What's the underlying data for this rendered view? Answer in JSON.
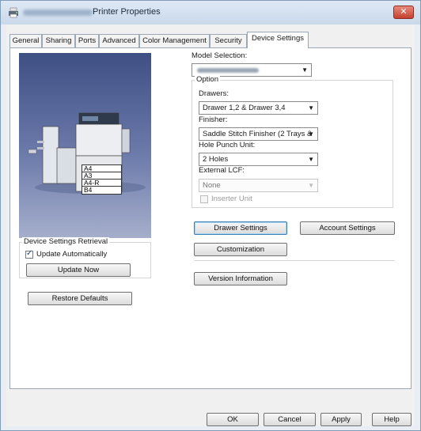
{
  "window": {
    "title": "Printer Properties",
    "close_glyph": "✕",
    "icon": "printer-icon"
  },
  "tabs": [
    {
      "label": "General"
    },
    {
      "label": "Sharing"
    },
    {
      "label": "Ports"
    },
    {
      "label": "Advanced"
    },
    {
      "label": "Color Management"
    },
    {
      "label": "Security"
    },
    {
      "label": "Device Settings",
      "active": true
    }
  ],
  "device_image": {
    "paper_sizes": [
      "A4",
      "A3",
      "A4-R",
      "B4"
    ]
  },
  "model": {
    "label": "Model Selection:"
  },
  "option": {
    "group_title": "Option",
    "drawers_label": "Drawers:",
    "drawers_value": "Drawer 1,2 & Drawer 3,4",
    "finisher_label": "Finisher:",
    "finisher_value": "Saddle Stitch Finisher (2 Trays &",
    "hole_punch_label": "Hole Punch Unit:",
    "hole_punch_value": "2 Holes",
    "external_lcf_label": "External LCF:",
    "external_lcf_value": "None",
    "inserter_label": "Inserter Unit",
    "inserter_checked": false
  },
  "retrieval": {
    "group_title": "Device Settings Retrieval",
    "update_auto_label": "Update Automatically",
    "update_auto_checked": true,
    "update_now_label": "Update Now"
  },
  "buttons": {
    "restore_defaults": "Restore Defaults",
    "drawer_settings": "Drawer Settings",
    "account_settings": "Account Settings",
    "customization": "Customization",
    "version_information": "Version Information"
  },
  "footer": {
    "ok": "OK",
    "cancel": "Cancel",
    "apply": "Apply",
    "help": "Help"
  }
}
